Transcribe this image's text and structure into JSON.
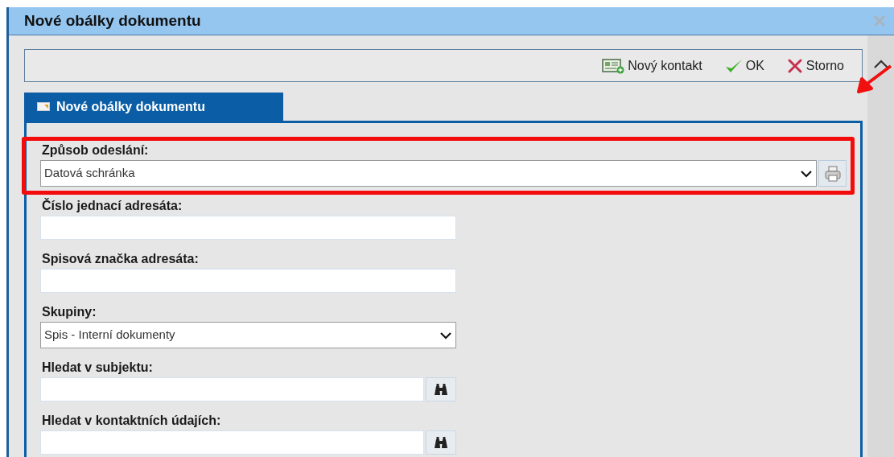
{
  "window": {
    "title": "Nové obálky dokumentu"
  },
  "toolbar": [
    {
      "label": "Nový kontakt",
      "kind": "contact"
    },
    {
      "label": "OK",
      "kind": "ok"
    },
    {
      "label": "Storno",
      "kind": "cancel"
    }
  ],
  "tab": {
    "label": "Nové obálky dokumentu",
    "selected": true
  },
  "fields": [
    {
      "label": "Způsob odeslání:",
      "kind": "select",
      "value": "Datová schránka",
      "print_button": true,
      "highlighted": true
    },
    {
      "label": "Číslo jednací adresáta:",
      "kind": "text",
      "highlighted": false
    },
    {
      "label": "Spisová značka adresáta:",
      "kind": "text",
      "highlighted": false
    },
    {
      "label": "Skupiny:",
      "kind": "select",
      "value": "Spis - Interní dokumenty",
      "highlighted": false
    },
    {
      "label": "Hledat v subjektu:",
      "kind": "text",
      "search_button": true,
      "highlighted": false
    },
    {
      "label": "Hledat v kontaktních údajích:",
      "kind": "text",
      "search_button": true,
      "highlighted": false
    }
  ]
}
